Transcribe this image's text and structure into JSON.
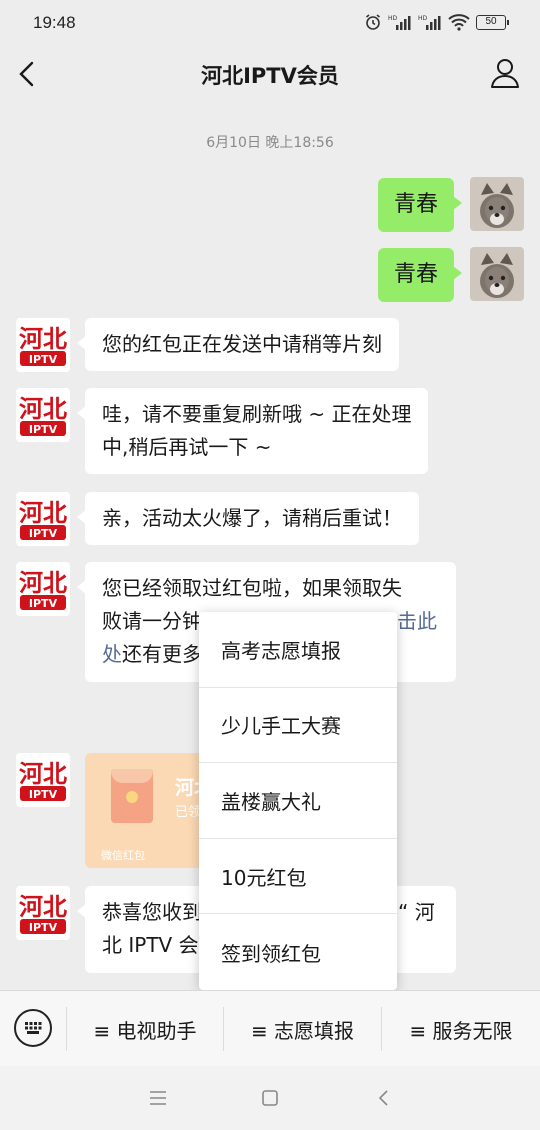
{
  "status_bar": {
    "time": "19:48",
    "battery": "50"
  },
  "header": {
    "title": "河北IPTV会员"
  },
  "chat": {
    "date_divider": "6月10日 晚上18:56",
    "sent": [
      {
        "text": "青春"
      },
      {
        "text": "青春"
      }
    ],
    "bot_logo": {
      "top": "河北",
      "bottom": "IPTV"
    },
    "received": [
      {
        "lines": [
          "您的红包正在发送中请稍等片刻"
        ]
      },
      {
        "lines": [
          "哇，请不要重复刷新哦 ~ 正在处理",
          "中,稍后再试一下 ~"
        ]
      },
      {
        "lines": [
          "亲，活动太火爆了，请稍后重试！"
        ]
      },
      {
        "lines": [
          "您已经领取过红包啦，如果领取失",
          "败请一分钟"
        ],
        "link_a": "击此",
        "link_b": "处",
        "tail": "还有更多"
      },
      {
        "lines": [
          "恭喜您收到",
          "北 IPTV 会"
        ],
        "tail": "“ 河"
      }
    ],
    "red_packet": {
      "title": "河北",
      "status": "已领",
      "label": "微信红包"
    }
  },
  "popup_menu": {
    "items": [
      "高考志愿填报",
      "少儿手工大赛",
      "盖楼赢大礼",
      "10元红包",
      "签到领红包"
    ]
  },
  "bottom_menu": {
    "tabs": [
      "≡ 电视助手",
      "≡ 志愿填报",
      "≡ 服务无限"
    ]
  },
  "colors": {
    "sent_bubble": "#95ec69",
    "link": "#576b95",
    "logo_red": "#d0121b"
  }
}
